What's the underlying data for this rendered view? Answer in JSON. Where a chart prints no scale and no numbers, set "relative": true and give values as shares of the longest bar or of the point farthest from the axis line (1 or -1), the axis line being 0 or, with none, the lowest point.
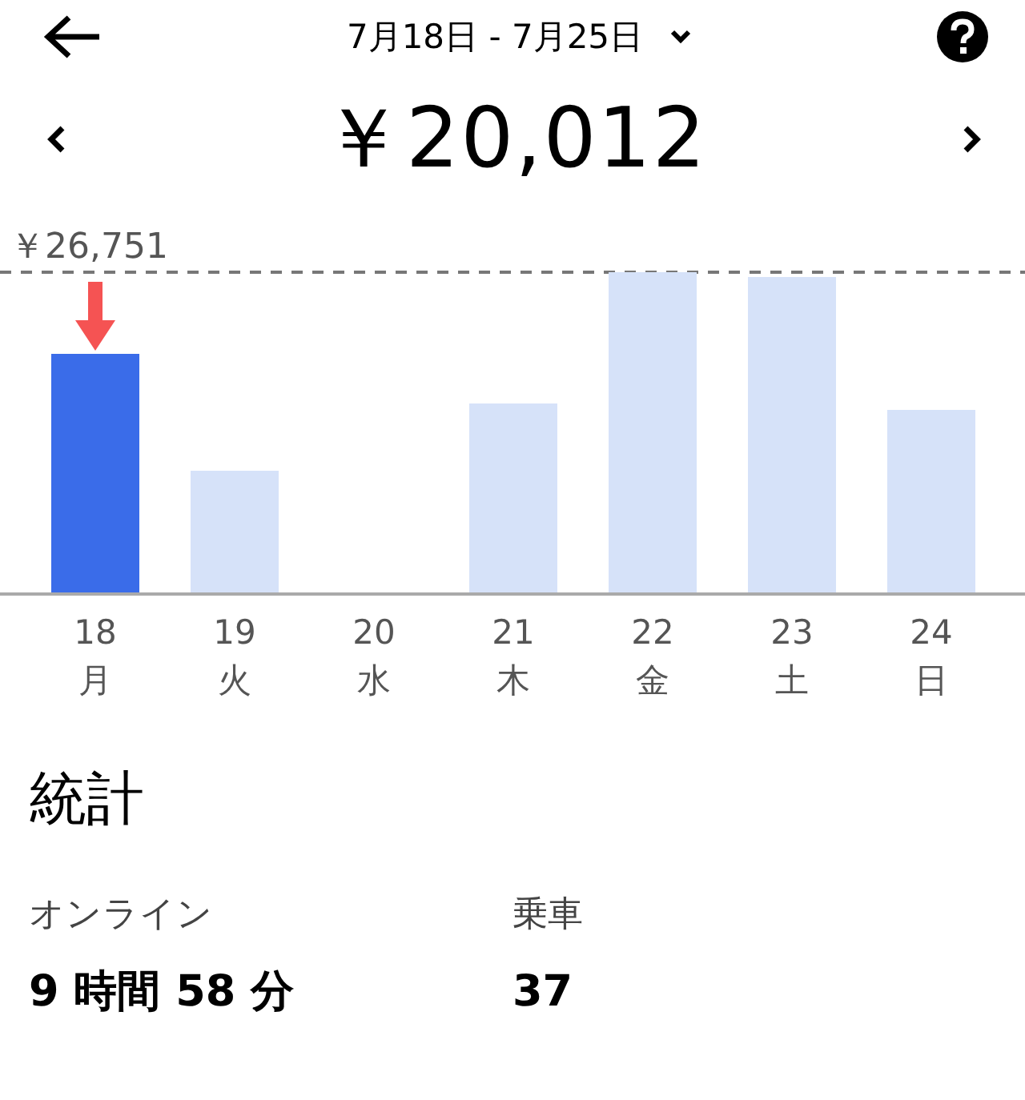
{
  "header": {
    "date_range": "7月18日 - 7月25日"
  },
  "total": {
    "amount": "￥20,012"
  },
  "chart": {
    "weekdays": [
      "月",
      "火",
      "水",
      "木",
      "金",
      "土",
      "日"
    ],
    "chart_data": {
      "type": "bar",
      "relative": true,
      "categories": [
        "18",
        "19",
        "20",
        "21",
        "22",
        "23",
        "24"
      ],
      "series": [
        {
          "color": "#3a6ce9",
          "values": [
            0.745,
            null,
            null,
            null,
            null,
            null,
            null
          ]
        },
        {
          "color": "#d6e2f9",
          "values": [
            null,
            0.38,
            0,
            0.59,
            1,
            0.985,
            0.57
          ]
        }
      ],
      "annotations": [
        {
          "text": "￥26,751"
        }
      ]
    }
  },
  "stats": {
    "title": "統計",
    "items": [
      {
        "label": "オンライン",
        "value": "9 時間 58 分"
      },
      {
        "label": "乗車",
        "value": "37"
      }
    ]
  }
}
